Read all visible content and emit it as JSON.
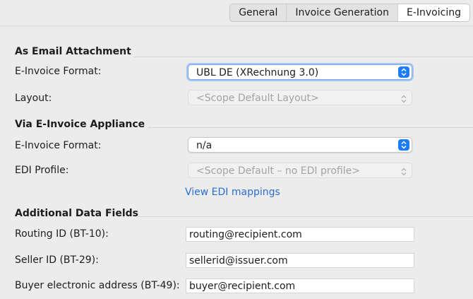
{
  "tabs": [
    {
      "label": "General"
    },
    {
      "label": "Invoice Generation"
    },
    {
      "label": "E-Invoicing"
    }
  ],
  "selected_tab": "E-Invoicing",
  "sections": {
    "email_attachment": {
      "title": "As Email Attachment",
      "format_label": "E-Invoice Format:",
      "format_value": "UBL DE (XRechnung 3.0)",
      "layout_label": "Layout:",
      "layout_value": "<Scope Default Layout>"
    },
    "appliance": {
      "title": "Via E-Invoice Appliance",
      "format_label": "E-Invoice Format:",
      "format_value": "n/a",
      "edi_label": "EDI Profile:",
      "edi_value": "<Scope Default – no EDI profile>",
      "edi_link": "View EDI mappings"
    },
    "additional": {
      "title": "Additional Data Fields",
      "routing_label": "Routing ID (BT-10):",
      "routing_value": "routing@recipient.com",
      "seller_label": "Seller ID (BT-29):",
      "seller_value": "sellerid@issuer.com",
      "buyer_label": "Buyer electronic address (BT-49):",
      "buyer_value": "buyer@recipient.com"
    }
  },
  "colors": {
    "accent": "#1b7cf4",
    "link": "#2a6fd1",
    "background": "#ececec"
  }
}
